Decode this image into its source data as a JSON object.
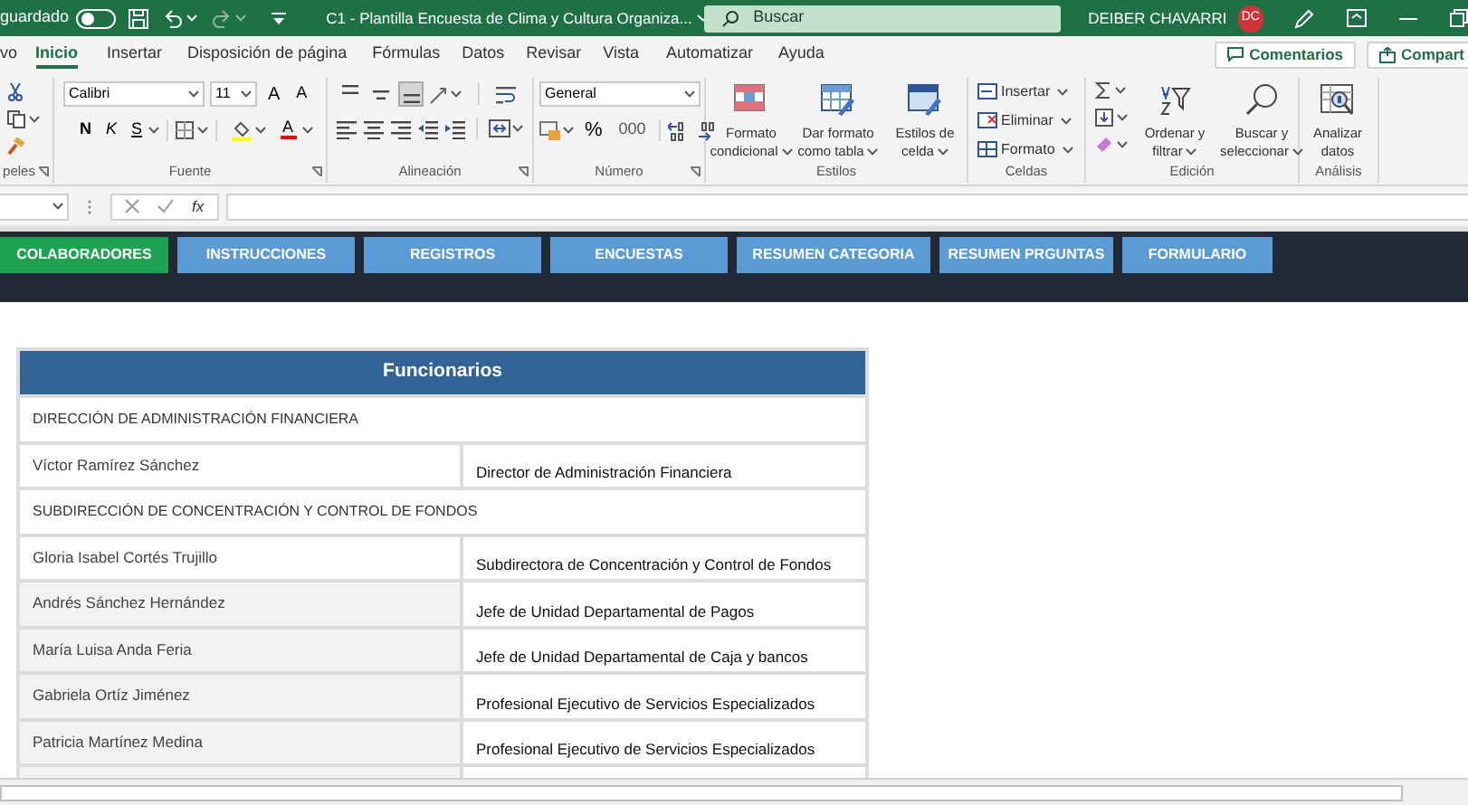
{
  "title_bar": {
    "autosave_label": "guardado",
    "autosave_on": false,
    "document_title": "C1 - Plantilla Encuesta de Clima y Cultura Organiza...",
    "search_placeholder": "Buscar",
    "user_name": "DEIBER CHAVARRI",
    "user_initials": "DC"
  },
  "ribbon_tabs": [
    {
      "label": "vo",
      "selected": false
    },
    {
      "label": "Inicio",
      "selected": true
    },
    {
      "label": "Insertar",
      "selected": false
    },
    {
      "label": "Disposición de página",
      "selected": false
    },
    {
      "label": "Fórmulas",
      "selected": false
    },
    {
      "label": "Datos",
      "selected": false
    },
    {
      "label": "Revisar",
      "selected": false
    },
    {
      "label": "Vista",
      "selected": false
    },
    {
      "label": "Automatizar",
      "selected": false
    },
    {
      "label": "Ayuda",
      "selected": false
    }
  ],
  "ribbon_actions": [
    "Comentarios",
    "Compart"
  ],
  "ribbon": {
    "clipboard": {
      "label": "peles"
    },
    "font": {
      "label": "Fuente",
      "font_name": "Calibri",
      "font_size": "11",
      "grow": "A",
      "shrink": "A",
      "bold": "N",
      "italic": "K",
      "underline": "S",
      "font_color": "A"
    },
    "alignment": {
      "label": "Alineación",
      "vertical_align_buttons": [
        {
          "selected": false
        },
        {
          "selected": false
        },
        {
          "selected": true
        }
      ]
    },
    "number": {
      "label": "Número",
      "format": "General",
      "percent": "%",
      "thousands": "000"
    },
    "styles": {
      "label": "Estilos",
      "buttons": [
        {
          "line1": "Formato",
          "line2": "condicional"
        },
        {
          "line1": "Dar formato",
          "line2": "como tabla"
        },
        {
          "line1": "Estilos de",
          "line2": "celda"
        }
      ]
    },
    "cells": {
      "label": "Celdas",
      "buttons": [
        "Insertar",
        "Eliminar",
        "Formato"
      ]
    },
    "editing": {
      "label": "Edición",
      "buttons": [
        {
          "line1": "Ordenar y",
          "line2": "filtrar"
        },
        {
          "line1": "Buscar y",
          "line2": "seleccionar"
        }
      ]
    },
    "analysis": {
      "label": "Análisis",
      "buttons": [
        {
          "line1": "Analizar",
          "line2": "datos"
        }
      ]
    }
  },
  "formula_bar": {
    "function_label": "fx"
  },
  "nav_buttons": [
    {
      "label": "COLABORADORES",
      "selected": true
    },
    {
      "label": "INSTRUCCIONES",
      "selected": false
    },
    {
      "label": "REGISTROS",
      "selected": false
    },
    {
      "label": "ENCUESTAS",
      "selected": false
    },
    {
      "label": "RESUMEN CATEGORIA",
      "selected": false
    },
    {
      "label": "RESUMEN PRGUNTAS",
      "selected": false
    },
    {
      "label": "FORMULARIO",
      "selected": false
    }
  ],
  "table": {
    "title": "Funcionarios",
    "rows": [
      {
        "kind": "section",
        "text": "DIRECCIÓN DE ADMINISTRACIÓN FINANCIERA"
      },
      {
        "kind": "person",
        "name": "Víctor Ramírez Sánchez",
        "position": "Director de Administración Financiera",
        "shaded": false
      },
      {
        "kind": "section",
        "text": "SUBDIRECCIÓN DE CONCENTRACIÓN Y CONTROL DE FONDOS"
      },
      {
        "kind": "person",
        "name": "Gloria Isabel Cortés Trujillo",
        "position": "Subdirectora de Concentración y Control de Fondos",
        "shaded": false
      },
      {
        "kind": "person",
        "name": "Andrés Sánchez Hernández",
        "position": "Jefe de Unidad Departamental de Pagos",
        "shaded": true
      },
      {
        "kind": "person",
        "name": "María Luisa Anda Feria",
        "position": "Jefe de Unidad Departamental de Caja y bancos",
        "shaded": true
      },
      {
        "kind": "person",
        "name": "Gabriela Ortíz Jiménez",
        "position": "Profesional Ejecutivo de Servicios Especializados",
        "shaded": true
      },
      {
        "kind": "person",
        "name": "Patricia Martínez Medina",
        "position": "Profesional Ejecutivo de Servicios Especializados",
        "shaded": true
      }
    ]
  }
}
